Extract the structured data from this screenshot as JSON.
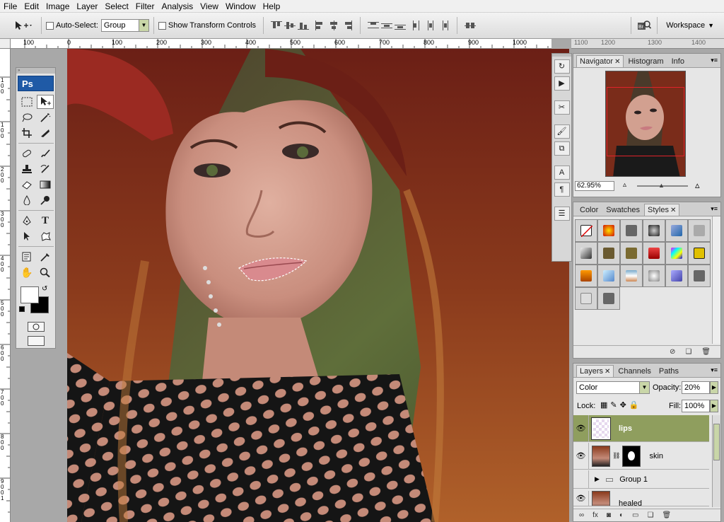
{
  "menu": [
    "File",
    "Edit",
    "Image",
    "Layer",
    "Select",
    "Filter",
    "Analysis",
    "View",
    "Window",
    "Help"
  ],
  "options": {
    "auto_select_label": "Auto-Select:",
    "auto_select_value": "Group",
    "show_transform_label": "Show Transform Controls",
    "workspace_label": "Workspace"
  },
  "ruler": {
    "top_ticks": [
      "100",
      "0",
      "100",
      "200",
      "300",
      "400",
      "500",
      "600",
      "700",
      "800",
      "900",
      "1000"
    ],
    "right_ticks": [
      "1100",
      "1200",
      "1300",
      "1400"
    ],
    "left_ticks": [
      "1",
      "0",
      "0",
      "1",
      "0",
      "0",
      "2",
      "0",
      "0",
      "3",
      "0",
      "0",
      "4",
      "0",
      "0",
      "5",
      "0",
      "0",
      "6",
      "0",
      "0",
      "7",
      "0",
      "0",
      "8",
      "0",
      "0",
      "9",
      "0",
      "0",
      "1",
      "0",
      "0",
      "0",
      "1",
      "1",
      "0",
      "0",
      "1",
      "2",
      "0",
      "0"
    ]
  },
  "toolbox": {
    "logo": "Ps"
  },
  "navigator": {
    "tabs": [
      "Navigator",
      "Histogram",
      "Info"
    ],
    "zoom": "62.95%"
  },
  "styles_panel": {
    "tabs": [
      "Color",
      "Swatches",
      "Styles"
    ]
  },
  "layers_panel": {
    "tabs": [
      "Layers",
      "Channels",
      "Paths"
    ],
    "blend_mode": "Color",
    "opacity_label": "Opacity:",
    "opacity_value": "20%",
    "lock_label": "Lock:",
    "fill_label": "Fill:",
    "fill_value": "100%",
    "layers": [
      {
        "name": "lips",
        "visible": true,
        "selected": true
      },
      {
        "name": "skin",
        "visible": true,
        "selected": false
      },
      {
        "name": "Group 1",
        "visible": false,
        "selected": false
      },
      {
        "name": "healed",
        "visible": true,
        "selected": false
      }
    ]
  },
  "colors": {
    "accent_selected_layer": "#8f9e5e",
    "ps_logo": "#1f5aa6",
    "navigator_box": "#e0232b"
  }
}
